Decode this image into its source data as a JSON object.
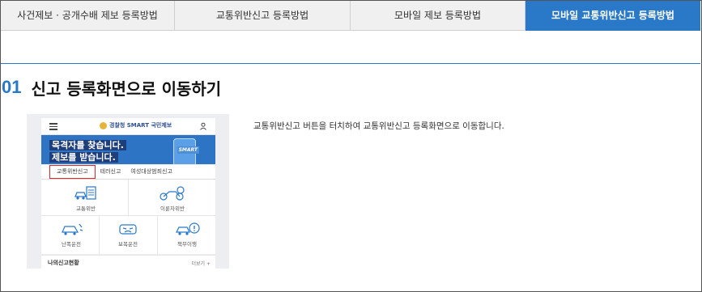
{
  "tabs": [
    {
      "label": "사건제보 · 공개수배 제보 등록방법",
      "active": false
    },
    {
      "label": "교통위반신고 등록방법",
      "active": false
    },
    {
      "label": "모바일 제보 등록방법",
      "active": false
    },
    {
      "label": "모바일 교통위반신고 등록방법",
      "active": true
    }
  ],
  "step": {
    "number": "01",
    "title": "신고 등록화면으로 이동하기"
  },
  "description": "교통위반신고 버튼을 터치하여 교통위반신고 등록화면으로 이동합니다.",
  "phone": {
    "logo_text": "경찰청 SMART 국민제보",
    "banner_line1": "목격자를 찾습니다.",
    "banner_line2": "제보를 받습니다.",
    "banner_badge": "SMART",
    "subtabs": [
      "교통위반신고",
      "테러신고",
      "여성대상범죄신고"
    ],
    "menu": [
      "교통위반",
      "이륜차위반",
      "난폭운전",
      "보복운전",
      "책무이행"
    ],
    "report_status": "나의신고현황",
    "more": "더보기 +"
  },
  "colors": {
    "accent": "#2a79c9",
    "highlight_border": "#e0252b"
  }
}
